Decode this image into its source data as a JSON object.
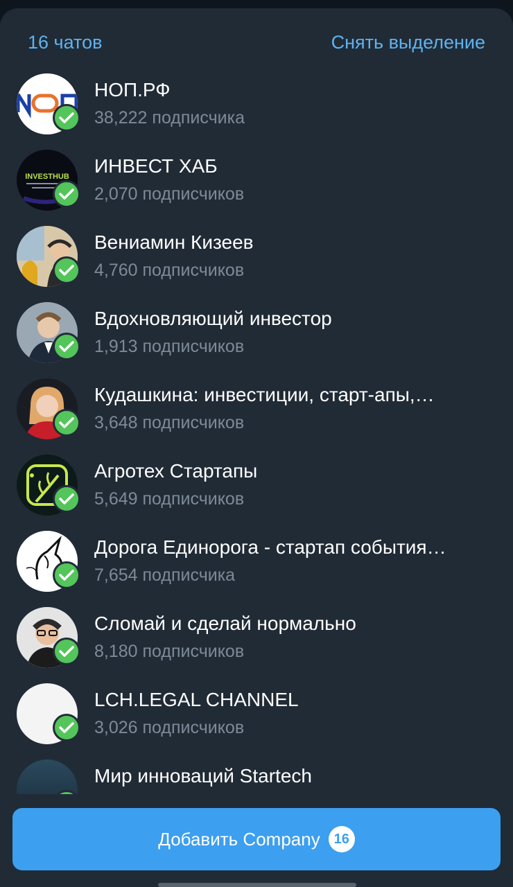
{
  "header": {
    "chat_count": "16 чатов",
    "deselect_label": "Снять выделение"
  },
  "chats": [
    {
      "title": "НОП.РФ",
      "subscribers": "38,222 подписчика",
      "avatar": "nop-logo"
    },
    {
      "title": "ИНВЕСТ ХАБ",
      "subscribers": "2,070 подписчиков",
      "avatar": "investhub-logo",
      "avatar_text": "INVESTHUB"
    },
    {
      "title": "Вениамин Кизеев",
      "subscribers": "4,760 подписчиков",
      "avatar": "person-photo"
    },
    {
      "title": "Вдохновляющий инвестор",
      "subscribers": "1,913 подписчиков",
      "avatar": "person-photo"
    },
    {
      "title": "Кудашкина: инвестиции, старт-апы,…",
      "subscribers": "3,648 подписчиков",
      "avatar": "person-photo"
    },
    {
      "title": "Агротех Стартапы",
      "subscribers": "5,649 подписчиков",
      "avatar": "agrotech-logo"
    },
    {
      "title": "Дорога Единорога - стартап события…",
      "subscribers": "7,654 подписчика",
      "avatar": "unicorn-logo"
    },
    {
      "title": "Сломай и сделай нормально",
      "subscribers": "8,180 подписчиков",
      "avatar": "person-photo"
    },
    {
      "title": "LCH.LEGAL CHANNEL",
      "subscribers": "3,026 подписчиков",
      "avatar": "blank-avatar"
    },
    {
      "title": "Мир инноваций Startech",
      "subscribers": "",
      "avatar": "startech-logo"
    }
  ],
  "add_button": {
    "label": "Добавить Company",
    "count": "16"
  },
  "colors": {
    "background": "#212b36",
    "accent": "#5eb3f0",
    "button": "#3c9ff0",
    "check": "#53c55a",
    "subtitle": "#7d8a98"
  }
}
